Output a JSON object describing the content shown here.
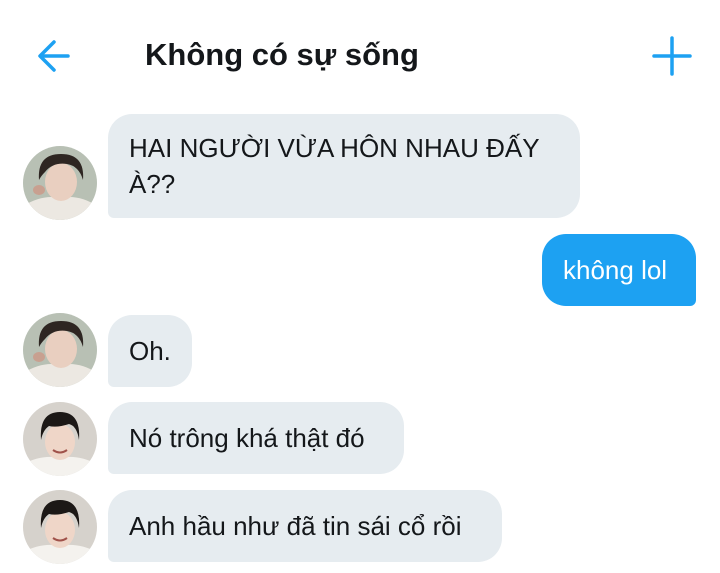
{
  "header": {
    "title": "Không có sự sống",
    "back_icon": "arrow-left-icon",
    "add_icon": "plus-icon",
    "accent_color": "#1da1f2"
  },
  "messages": [
    {
      "from": "them",
      "avatar": "avatar-a",
      "text_line1": "HAI NGƯỜI VỪA HÔN NHAU ĐẤY",
      "text_line2": "À??"
    },
    {
      "from": "me",
      "text": "không lol"
    },
    {
      "from": "them",
      "avatar": "avatar-a",
      "text": "Oh."
    },
    {
      "from": "them",
      "avatar": "avatar-b",
      "text": "Nó trông khá thật đó"
    },
    {
      "from": "them",
      "avatar": "avatar-b",
      "text": "Anh hầu như đã tin sái cổ rồi"
    }
  ],
  "colors": {
    "incoming_bubble": "#e6ecf0",
    "outgoing_bubble": "#1da1f2",
    "text": "#14171a"
  }
}
